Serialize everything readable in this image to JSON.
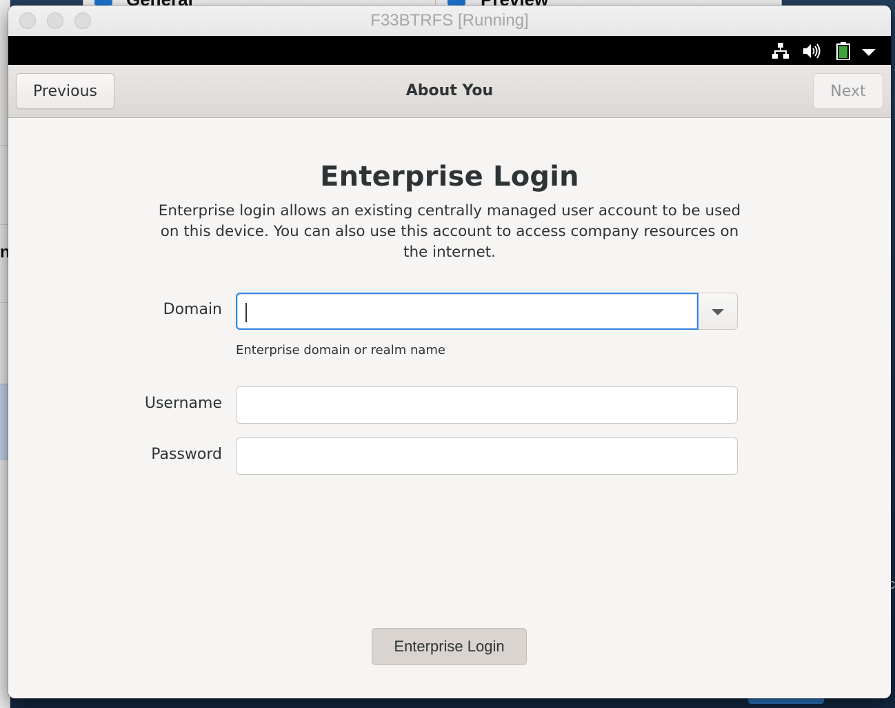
{
  "host": {
    "left_glyph": "n",
    "right_glyph": "c",
    "top_tabs": [
      {
        "label": "General"
      },
      {
        "label": "Preview"
      }
    ]
  },
  "vm_window": {
    "title": "F33BTRFS [Running]"
  },
  "gnome_topbar": {
    "tray_icons": [
      "network-icon",
      "volume-icon",
      "battery-icon",
      "system-menu-arrow-icon"
    ],
    "battery_color": "#3fa33b"
  },
  "header": {
    "previous_label": "Previous",
    "title": "About You",
    "next_label": "Next"
  },
  "page": {
    "heading": "Enterprise Login",
    "description": "Enterprise login allows an existing centrally managed user account to be used on this device. You can also use this account to access company resources on the internet.",
    "domain_label": "Domain",
    "domain_value": "",
    "domain_hint": "Enterprise domain or realm name",
    "username_label": "Username",
    "username_value": "",
    "password_label": "Password",
    "password_value": "",
    "submit_label": "Enterprise Login"
  },
  "colors": {
    "focus_accent": "#3584e4",
    "host_accent": "#1b76d2"
  }
}
